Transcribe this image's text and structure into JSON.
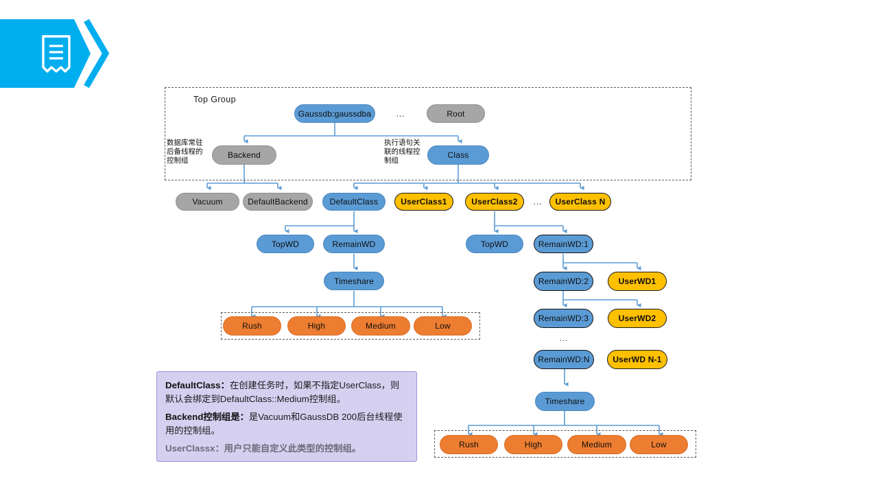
{
  "banner": {
    "icon": "document-icon",
    "color": "#00AEEF"
  },
  "diagram": {
    "top_group_label": "Top Group",
    "annotations": {
      "left": "数据库常驻后备线程的控制组",
      "right": "执行语句关联的线程控制组"
    },
    "ellipsis": "…",
    "nodes": {
      "gaussdb": "Gaussdb:gaussdba",
      "root": "Root",
      "backend": "Backend",
      "class": "Class",
      "vacuum": "Vacuum",
      "default_backend": "DefaultBackend",
      "default_class": "DefaultClass",
      "user_class1": "UserClass1",
      "user_class2": "UserClass2",
      "user_class_n": "UserClass N",
      "left_topwd": "TopWD",
      "left_remainwd": "RemainWD",
      "left_timeshare": "Timeshare",
      "right_topwd": "TopWD",
      "right_remainwd1": "RemainWD:1",
      "right_remainwd2": "RemainWD:2",
      "right_remainwd3": "RemainWD:3",
      "right_remainwd_n": "RemainWD:N",
      "right_timeshare": "Timeshare",
      "userwd1": "UserWD1",
      "userwd2": "UserWD2",
      "userwd_n1": "UserWD N-1"
    },
    "priorities_left": [
      "Rush",
      "High",
      "Medium",
      "Low"
    ],
    "priorities_right": [
      "Rush",
      "High",
      "Medium",
      "Low"
    ],
    "colors": {
      "blue": "#5B9BD5",
      "gray": "#A6A6A6",
      "yellow": "#FFC000",
      "orange": "#ED7D31",
      "connector": "#5B9BD5",
      "dash": "#58595B",
      "note_bg": "#D5D0F0"
    }
  },
  "note": {
    "line1_bold": "DefaultClass：",
    "line1_text": "在创建任务时，如果不指定UserClass，则默认会绑定到DefaultClass::Medium控制组。",
    "line2_bold": "Backend控制组是：",
    "line2_text": "是Vacuum和GaussDB 200后台线程使用的控制组。",
    "line3": "UserClassx：用户只能自定义此类型的控制组。"
  }
}
